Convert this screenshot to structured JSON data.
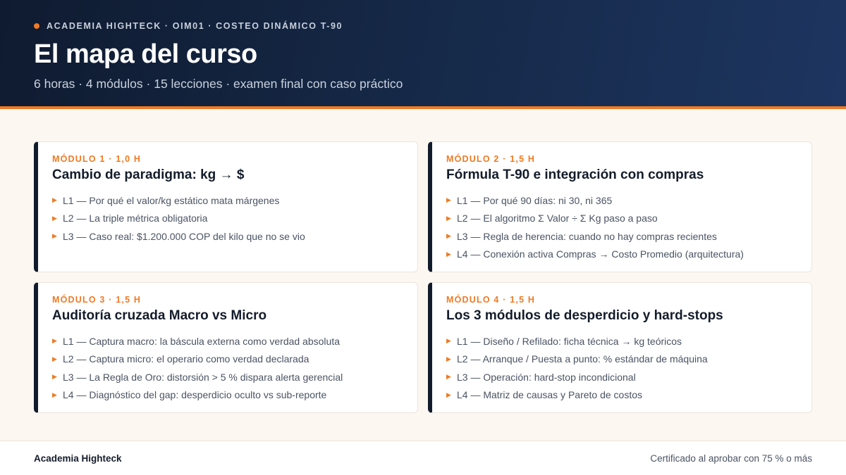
{
  "header": {
    "kicker": "ACADEMIA HIGHTECK · OIM01 · COSTEO DINÁMICO T-90",
    "title": "El mapa del curso",
    "subtitle": "6 horas · 4 módulos · 15 lecciones · examen final con caso práctico"
  },
  "colors": {
    "accent": "#f07a23",
    "header_bg": "#162a4a",
    "card_border_left": "#111b2b",
    "page_bg": "#fdf7f2"
  },
  "modules": [
    {
      "label": "MÓDULO 1 · 1,0 H",
      "title": "Cambio de paradigma: kg → $",
      "lessons": [
        "L1 — Por qué el valor/kg estático mata márgenes",
        "L2 — La triple métrica obligatoria",
        "L3 — Caso real: $1.200.000 COP del kilo que no se vio"
      ]
    },
    {
      "label": "MÓDULO 2 · 1,5 H",
      "title": "Fórmula T-90 e integración con compras",
      "lessons": [
        "L1 — Por qué 90 días: ni 30, ni 365",
        "L2 — El algoritmo Σ Valor ÷ Σ Kg paso a paso",
        "L3 — Regla de herencia: cuando no hay compras recientes",
        "L4 — Conexión activa Compras → Costo Promedio (arquitectura)"
      ]
    },
    {
      "label": "MÓDULO 3 · 1,5 H",
      "title": "Auditoría cruzada Macro vs Micro",
      "lessons": [
        "L1 — Captura macro: la báscula externa como verdad absoluta",
        "L2 — Captura micro: el operario como verdad declarada",
        "L3 — La Regla de Oro: distorsión > 5 % dispara alerta gerencial",
        "L4 — Diagnóstico del gap: desperdicio oculto vs sub-reporte"
      ]
    },
    {
      "label": "MÓDULO 4 · 1,5 H",
      "title": "Los 3 módulos de desperdicio y hard-stops",
      "lessons": [
        "L1 — Diseño / Refilado: ficha técnica → kg teóricos",
        "L2 — Arranque / Puesta a punto: % estándar de máquina",
        "L3 — Operación: hard-stop incondicional",
        "L4 — Matriz de causas y Pareto de costos"
      ]
    }
  ],
  "footer": {
    "brand": "Academia Highteck",
    "certificate": "Certificado al aprobar con 75 % o más"
  }
}
